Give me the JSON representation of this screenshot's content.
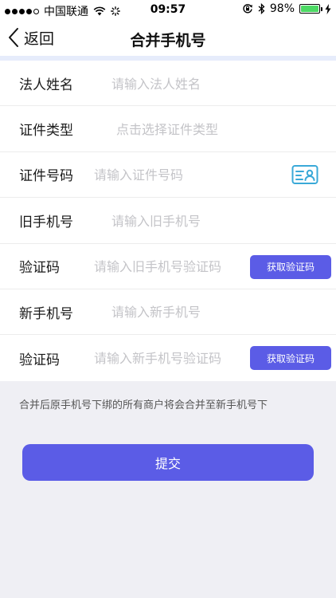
{
  "status_bar": {
    "carrier": "中国联通",
    "time": "09:57",
    "battery_percent": "98%"
  },
  "nav": {
    "back_label": "返回",
    "title": "合并手机号"
  },
  "form": {
    "legal_name": {
      "label": "法人姓名",
      "placeholder": "请输入法人姓名",
      "value": ""
    },
    "id_type": {
      "label": "证件类型",
      "placeholder": "点击选择证件类型",
      "value": ""
    },
    "id_number": {
      "label": "证件号码",
      "placeholder": "请输入证件号码",
      "value": ""
    },
    "old_phone": {
      "label": "旧手机号",
      "placeholder": "请输入旧手机号",
      "value": ""
    },
    "old_code": {
      "label": "验证码",
      "placeholder": "请输入旧手机号验证码",
      "value": "",
      "button_label": "获取验证码"
    },
    "new_phone": {
      "label": "新手机号",
      "placeholder": "请输入新手机号",
      "value": ""
    },
    "new_code": {
      "label": "验证码",
      "placeholder": "请输入新手机号验证码",
      "value": "",
      "button_label": "获取验证码"
    }
  },
  "note": "合并后原手机号下绑的所有商户将会合并至新手机号下",
  "submit_label": "提交",
  "colors": {
    "accent": "#5b5ce6",
    "id_card_icon": "#3aa9d8",
    "battery": "#4cd964",
    "background": "#efeff4"
  },
  "icons": {
    "back": "chevron-left-icon",
    "id_card": "id-card-icon",
    "wifi": "wifi-icon",
    "loading": "activity-spinner-icon",
    "lock_rotation": "orientation-lock-icon",
    "bluetooth": "bluetooth-icon",
    "battery": "battery-icon",
    "charging": "charging-bolt-icon"
  }
}
